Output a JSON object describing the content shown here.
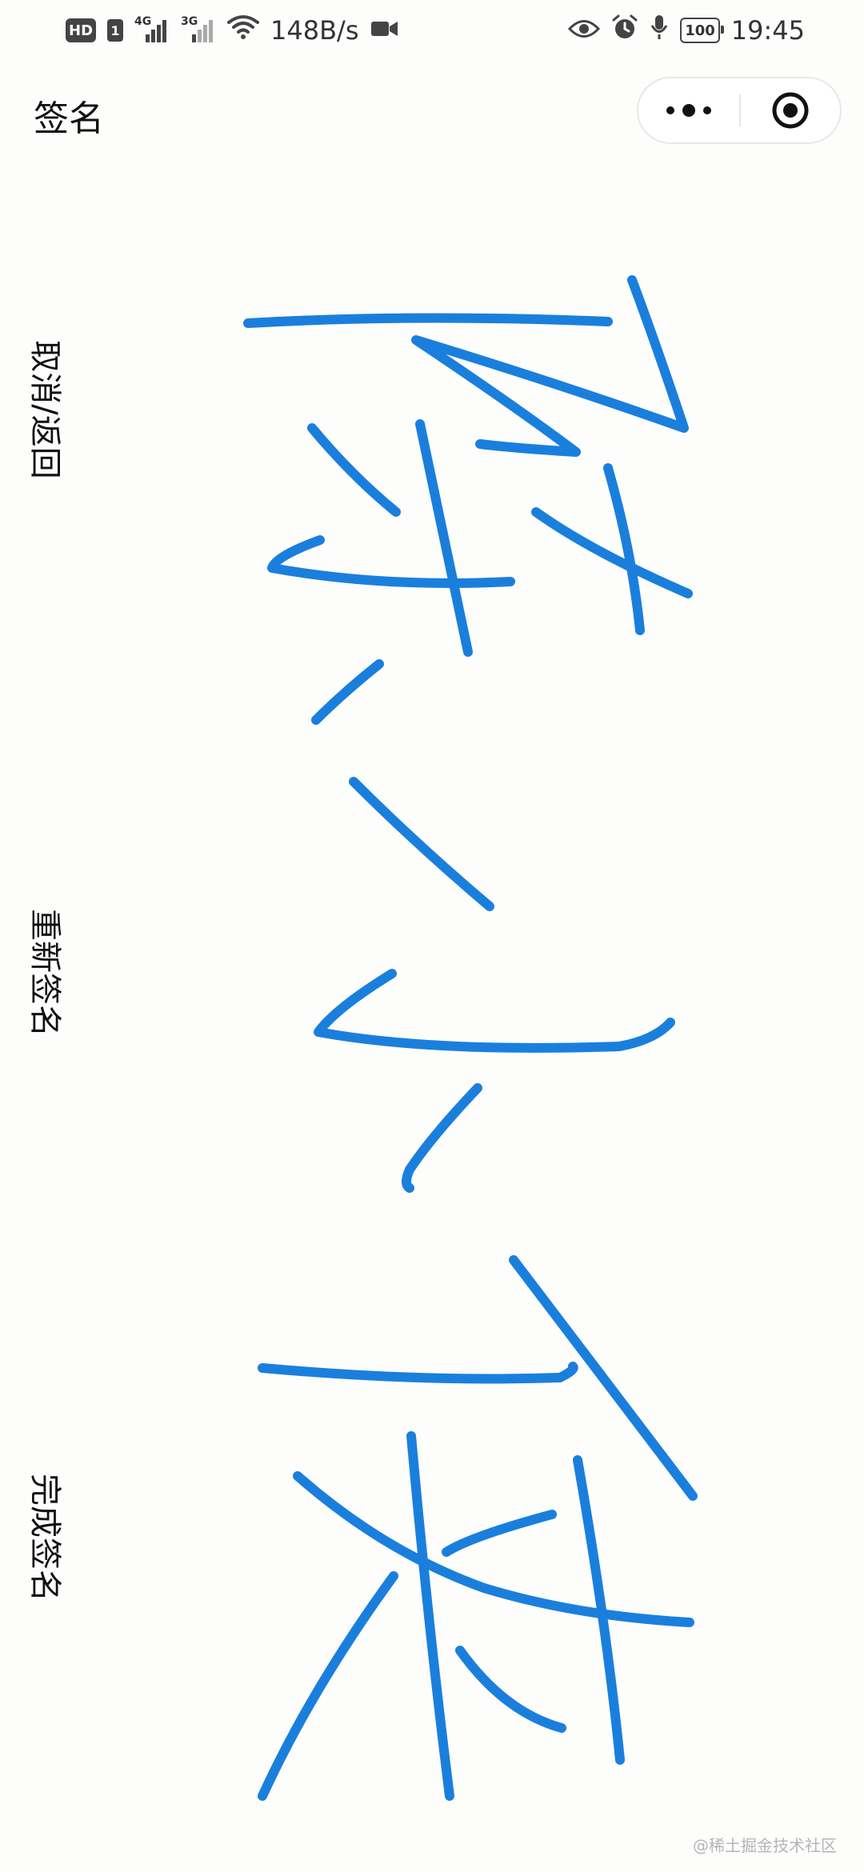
{
  "status_bar": {
    "hd_badge": "HD",
    "sim_slot": "1",
    "network_1": "4G",
    "network_2": "3G",
    "speed": "148B/s",
    "battery": "100",
    "time": "19:45",
    "icons": [
      "signal-icon",
      "wifi-icon",
      "video-camera-icon",
      "eye-icon",
      "alarm-icon",
      "microphone-icon",
      "battery-icon"
    ]
  },
  "header": {
    "title": "签名",
    "menu_icon": "more-dots-icon",
    "close_icon": "close-circle-icon"
  },
  "actions": {
    "cancel_label": "取消/返回",
    "reset_label": "重新签名",
    "confirm_label": "完成签名"
  },
  "signature": {
    "stroke_color": "#1a7fdc"
  },
  "watermark": "@稀土掘金技术社区"
}
